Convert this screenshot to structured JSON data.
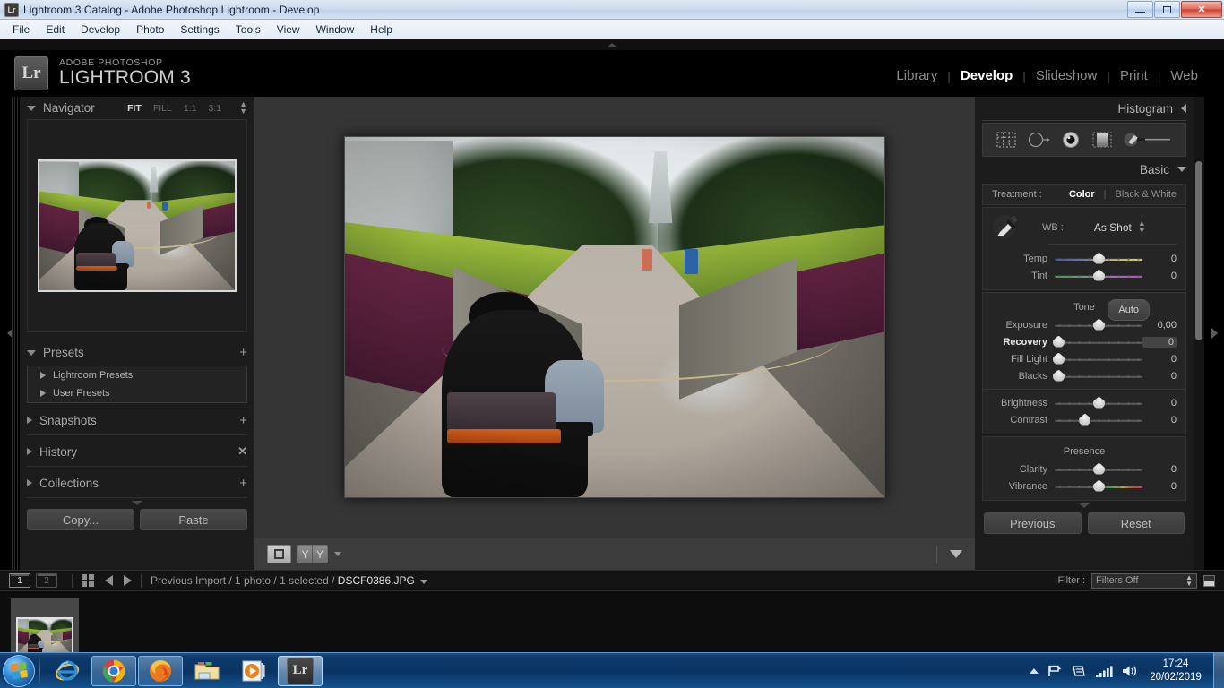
{
  "window": {
    "title": "Lightroom 3 Catalog - Adobe Photoshop Lightroom - Develop",
    "app_icon": "Lr",
    "minimize_label": "–",
    "restore_label": "❐",
    "close_label": "✕"
  },
  "menubar": {
    "items": [
      "File",
      "Edit",
      "Develop",
      "Photo",
      "Settings",
      "Tools",
      "View",
      "Window",
      "Help"
    ]
  },
  "identity": {
    "logo_text": "Lr",
    "brand_line1": "ADOBE PHOTOSHOP",
    "brand_line2": "LIGHTROOM 3"
  },
  "modules": {
    "items": [
      "Library",
      "Develop",
      "Slideshow",
      "Print",
      "Web"
    ],
    "active": "Develop",
    "separator": "|"
  },
  "left_panel": {
    "navigator": {
      "title": "Navigator",
      "zoom_levels": [
        "FIT",
        "FILL",
        "1:1",
        "3:1"
      ],
      "active_zoom": "FIT"
    },
    "presets": {
      "title": "Presets",
      "add_label": "+",
      "items": [
        "Lightroom Presets",
        "User Presets"
      ]
    },
    "snapshots": {
      "title": "Snapshots",
      "add_label": "+"
    },
    "history": {
      "title": "History",
      "clear_label": "✕"
    },
    "collections": {
      "title": "Collections",
      "add_label": "+"
    },
    "copy_button": "Copy...",
    "paste_button": "Paste"
  },
  "toolbar": {
    "loupe_tool": "loupe-view-icon",
    "compare_tool": "before-after-icon",
    "dropdown_label": "▾",
    "panel_toggle": "▾"
  },
  "right_panel": {
    "histogram": {
      "title": "Histogram",
      "collapse_label": "◀"
    },
    "tools": [
      "crop-overlay-icon",
      "spot-removal-icon",
      "red-eye-correction-icon",
      "graduated-filter-icon",
      "adjustment-brush-icon"
    ],
    "basic": {
      "title": "Basic",
      "collapse_label": "▼",
      "treatment_label": "Treatment :",
      "treatment_options": [
        "Color",
        "Black & White"
      ],
      "treatment_active": "Color",
      "wb_label": "WB :",
      "wb_value": "As Shot",
      "white_balance_sliders": [
        {
          "label": "Temp",
          "value": "0",
          "pos": 50,
          "kind": "temp"
        },
        {
          "label": "Tint",
          "value": "0",
          "pos": 50,
          "kind": "tint"
        }
      ],
      "tone_label": "Tone",
      "auto_label": "Auto",
      "tone_sliders": [
        {
          "label": "Exposure",
          "value": "0,00",
          "pos": 50,
          "kind": "plain",
          "bold": false
        },
        {
          "label": "Recovery",
          "value": "0",
          "pos": 4,
          "kind": "plain",
          "bold": true
        },
        {
          "label": "Fill Light",
          "value": "0",
          "pos": 4,
          "kind": "plain",
          "bold": false
        },
        {
          "label": "Blacks",
          "value": "0",
          "pos": 4,
          "kind": "plain",
          "bold": false
        }
      ],
      "tone_sliders2": [
        {
          "label": "Brightness",
          "value": "0",
          "pos": 50,
          "kind": "plain",
          "bold": false
        },
        {
          "label": "Contrast",
          "value": "0",
          "pos": 34,
          "kind": "plain",
          "bold": false
        }
      ],
      "presence_label": "Presence",
      "presence_sliders": [
        {
          "label": "Clarity",
          "value": "0",
          "pos": 50,
          "kind": "plain",
          "bold": false
        },
        {
          "label": "Vibrance",
          "value": "0",
          "pos": 50,
          "kind": "vibrance",
          "bold": false
        }
      ]
    },
    "previous_button": "Previous",
    "reset_button": "Reset"
  },
  "filmbar": {
    "screen_1": "1",
    "screen_2": "2",
    "grid_icon": "grid-view-icon",
    "back_icon": "previous-photo-icon",
    "forward_icon": "next-photo-icon",
    "breadcrumb": "Previous Import / 1 photo / 1 selected / ",
    "breadcrumb_file": "DSCF0386.JPG",
    "filter_label": "Filter :",
    "filter_value": "Filters Off"
  },
  "taskbar": {
    "start_label": "start-orb-icon",
    "apps": [
      "internet-explorer-icon",
      "google-chrome-icon",
      "mozilla-firefox-icon",
      "windows-explorer-icon",
      "windows-media-player-icon",
      "lightroom-icon"
    ],
    "tray": [
      "show-hidden-icons",
      "action-center-flag-icon",
      "network-icon",
      "signal-bars-icon",
      "volume-icon"
    ],
    "clock_time": "17:24",
    "clock_date": "20/02/2019"
  },
  "colors": {
    "panel_bg": "#1c1c1c",
    "center_bg": "#353535",
    "accent_text": "#ffffff",
    "muted_text": "#8d8d8d",
    "taskbar_blue": "#0a3464",
    "close_red": "#cf3f2e"
  }
}
